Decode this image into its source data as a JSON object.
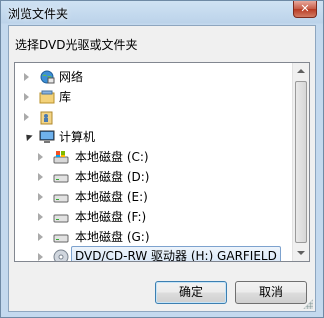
{
  "window": {
    "title": "浏览文件夹",
    "close_label": "✕"
  },
  "dialog": {
    "prompt": "选择DVD光驱或文件夹"
  },
  "tree": {
    "items": [
      {
        "label": "网络",
        "icon": "network-icon",
        "expanded": false
      },
      {
        "label": "库",
        "icon": "library-icon",
        "expanded": false
      },
      {
        "label": "",
        "icon": "user-folder-icon",
        "expanded": false
      },
      {
        "label": "计算机",
        "icon": "computer-icon",
        "expanded": true
      },
      {
        "label": "本地磁盘 (C:)",
        "icon": "system-drive-icon",
        "expanded": false
      },
      {
        "label": "本地磁盘 (D:)",
        "icon": "hard-drive-icon",
        "expanded": false
      },
      {
        "label": "本地磁盘 (E:)",
        "icon": "hard-drive-icon",
        "expanded": false
      },
      {
        "label": "本地磁盘 (F:)",
        "icon": "hard-drive-icon",
        "expanded": false
      },
      {
        "label": "本地磁盘 (G:)",
        "icon": "hard-drive-icon",
        "expanded": false
      },
      {
        "label": "DVD/CD-RW 驱动器 (H:) GARFIELD",
        "icon": "dvd-drive-icon",
        "expanded": false,
        "selected": true
      }
    ]
  },
  "buttons": {
    "ok_label": "确定",
    "cancel_label": "取消"
  }
}
